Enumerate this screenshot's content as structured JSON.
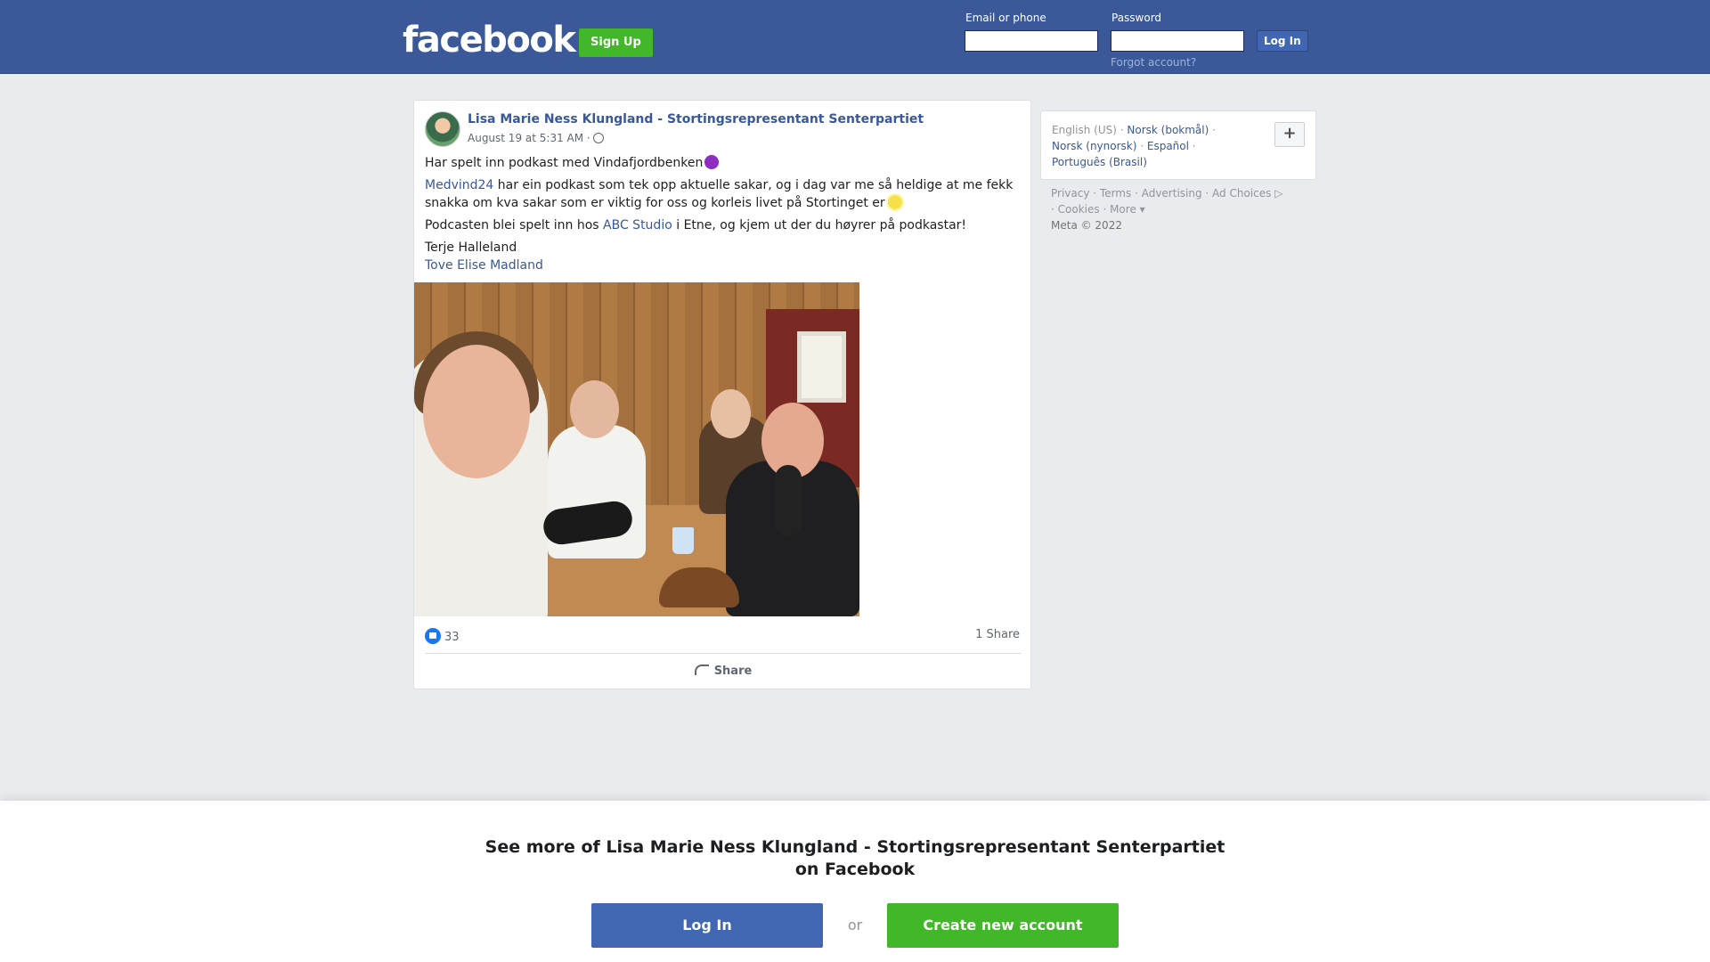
{
  "header": {
    "logo": "facebook",
    "signup_label": "Sign Up",
    "email_label": "Email or phone",
    "password_label": "Password",
    "login_label": "Log In",
    "forgot_label": "Forgot account?"
  },
  "post": {
    "author": "Lisa Marie Ness Klungland - Stortingsrepresentant Senterpartiet",
    "timestamp": "August 19 at 5:31 AM",
    "line1": "Har spelt inn podkast med Vindafjordbenken",
    "para2_link": "Medvind24",
    "para2_text": " har ein podkast som tek opp aktuelle sakar, og i dag var me så heldige at me fekk snakka om kva sakar som er viktig for oss og korleis livet på Stortinget er",
    "para3_pre": "Podcasten blei spelt inn hos ",
    "para3_link": "ABC Studio",
    "para3_post": " i Etne, og kjem ut der du høyrer på podkastar!",
    "tag1": "Terje Halleland",
    "tag2": "Tove Elise Madland",
    "likes_count": "33",
    "shares_count": "1 Share",
    "share_action": "Share"
  },
  "sidebar": {
    "languages": [
      "English (US)",
      "Norsk (bokmål)",
      "Norsk (nynorsk)",
      "Español",
      "Português (Brasil)"
    ],
    "add_language": "+",
    "footer": {
      "privacy": "Privacy",
      "terms": "Terms",
      "advertising": "Advertising",
      "ad_choices": "Ad Choices",
      "cookies": "Cookies",
      "more": "More",
      "copyright": "Meta © 2022"
    }
  },
  "banner": {
    "title": "See more of Lisa Marie Ness Klungland - Stortingsrepresentant Senterpartiet on Facebook",
    "login_label": "Log In",
    "or_label": "or",
    "create_label": "Create new account"
  },
  "colors": {
    "brand_blue": "#3b5998",
    "green": "#42b72a",
    "link": "#385898"
  }
}
